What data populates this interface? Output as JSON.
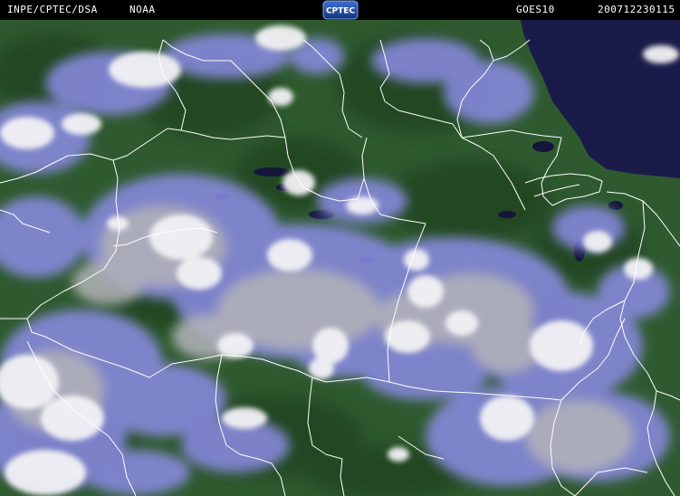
{
  "header": {
    "agency": "INPE/CPTEC/DSA",
    "source": "NOAA",
    "logo_text": "CPTEC",
    "satellite": "GOES10",
    "timestamp": "200712230115"
  },
  "colors": {
    "forest": "#2f5a2f",
    "forest_dark": "#244724",
    "ocean": "#1b1b4a",
    "cloud_white": "#f2f2f5",
    "cloud_blue": "#8c8ce6",
    "cloud_gray": "#b3b3b8",
    "border_line": "#ffffff",
    "water": "#15153a"
  }
}
